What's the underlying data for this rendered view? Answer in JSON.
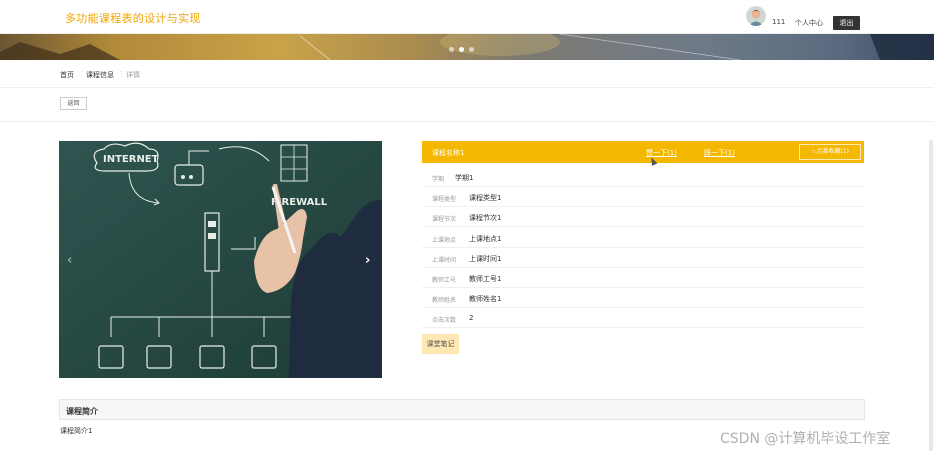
{
  "header": {
    "site_title": "多功能课程表的设计与实现",
    "username": "111",
    "profile_link": "个人中心",
    "logout": "退出"
  },
  "breadcrumb": {
    "home": "首页",
    "section": "课程信息",
    "current": "详情"
  },
  "back_button": "返回",
  "course": {
    "name": "课程名称1",
    "thumbup": "赞一下(1)",
    "thumbdown": "踩一下(1)",
    "favorite": "☆点我收藏(1)",
    "fields": [
      {
        "label": "学期",
        "value": "学期1"
      },
      {
        "label": "课程类型",
        "value": "课程类型1"
      },
      {
        "label": "课程节次",
        "value": "课程节次1"
      },
      {
        "label": "上课地点",
        "value": "上课地点1"
      },
      {
        "label": "上课时间",
        "value": "上课时间1"
      },
      {
        "label": "教师工号",
        "value": "教师工号1"
      },
      {
        "label": "教师姓名",
        "value": "教师姓名1"
      },
      {
        "label": "点击次数",
        "value": "2"
      }
    ],
    "notes_button": "课堂笔记"
  },
  "carousel": {
    "texts": [
      "INTERNET",
      "FIREWALL"
    ]
  },
  "intro": {
    "title": "课程简介",
    "text": "课程简介1"
  },
  "watermark": "CSDN @计算机毕设工作室",
  "colors": {
    "accent": "#f5b800",
    "title_color": "#f0a500"
  }
}
